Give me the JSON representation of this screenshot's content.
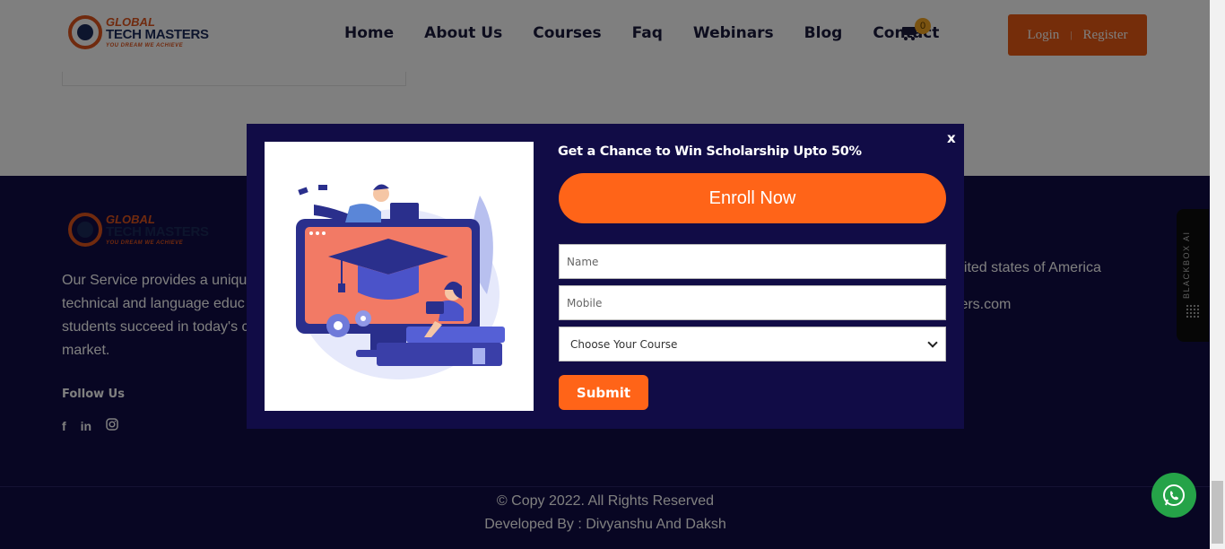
{
  "brand": {
    "line1": "GLOBAL",
    "line2": "TECH MASTERS",
    "tagline": "YOU DREAM WE ACHIEVE",
    "accent_color": "#e1541c",
    "navy_color": "#1b2a5a"
  },
  "nav": {
    "items": [
      "Home",
      "About Us",
      "Courses",
      "Faq",
      "Webinars",
      "Blog",
      "Contact"
    ],
    "cart_count": "0",
    "login_label": "Login",
    "separator": "|",
    "register_label": "Register"
  },
  "footer": {
    "description": "Our Service provides a uniqu technical and language educ students succeed in today's c market.",
    "follow_label": "Follow Us",
    "social_icons": [
      "facebook-icon",
      "linkedin-icon",
      "instagram-icon"
    ],
    "address_partial": "nited states of America",
    "email_partial": "ters.com",
    "copyright": "© Copy 2022. All Rights Reserved",
    "developed_by": "Developed By : Divyanshu And Daksh",
    "background_color": "#110c46"
  },
  "blackbox": {
    "label": "BLACKBOX AI"
  },
  "modal": {
    "close_label": "x",
    "promo_text": "Get a Chance to Win Scholarship Upto 50%",
    "enroll_label": "Enroll Now",
    "name_placeholder": "Name",
    "mobile_placeholder": "Mobile",
    "course_selected": "Choose Your Course",
    "submit_label": "Submit",
    "accent_color": "#ff6418"
  }
}
